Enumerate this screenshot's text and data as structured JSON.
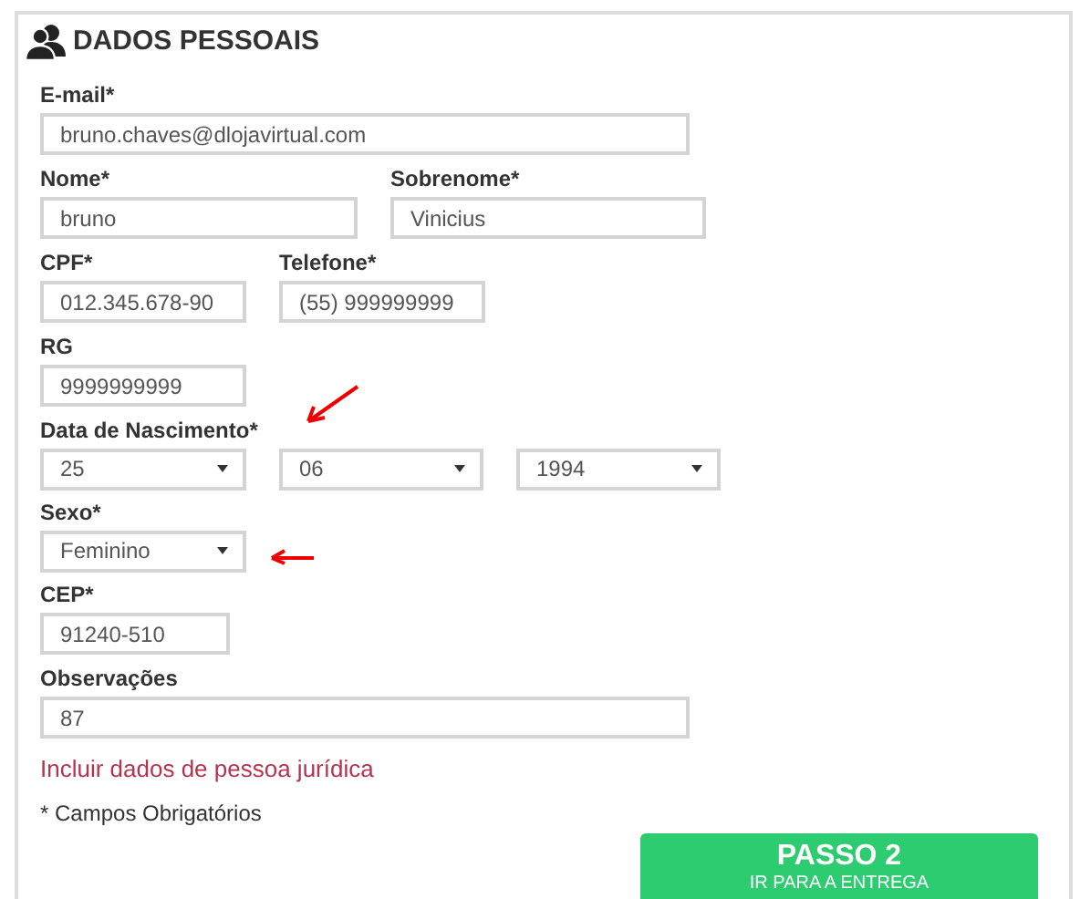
{
  "section": {
    "title": "DADOS PESSOAIS"
  },
  "rows": [
    {
      "fields": [
        {
          "label": "E-mail*",
          "value": "bruno.chaves@dlojavirtual.com",
          "kind": "text"
        }
      ]
    },
    {
      "fields": [
        {
          "label": "Nome*",
          "value": "bruno",
          "kind": "text"
        },
        {
          "label": "Sobrenome*",
          "value": "Vinicius",
          "kind": "text"
        }
      ]
    },
    {
      "fields": [
        {
          "label": "CPF*",
          "value": "012.345.678-90",
          "kind": "text"
        },
        {
          "label": "Telefone*",
          "value": "(55) 999999999",
          "kind": "text"
        }
      ]
    },
    {
      "fields": [
        {
          "label": "RG",
          "value": "9999999999",
          "kind": "text"
        }
      ]
    },
    {
      "label": "Data de Nascimento*",
      "fields": [
        {
          "value": "25",
          "kind": "select"
        },
        {
          "value": "06",
          "kind": "select"
        },
        {
          "value": "1994",
          "kind": "select"
        }
      ]
    },
    {
      "fields": [
        {
          "label": "Sexo*",
          "value": "Feminino",
          "kind": "select"
        }
      ]
    },
    {
      "fields": [
        {
          "label": "CEP*",
          "value": "91240-510",
          "kind": "text"
        }
      ]
    },
    {
      "fields": [
        {
          "label": "Observações",
          "value": "87",
          "kind": "text"
        }
      ]
    }
  ],
  "company_link": "Incluir dados de pessoa jurídica",
  "required_note": "* Campos Obrigatórios",
  "next_button": {
    "title": "PASSO 2",
    "subtitle": "IR PARA A ENTREGA"
  }
}
